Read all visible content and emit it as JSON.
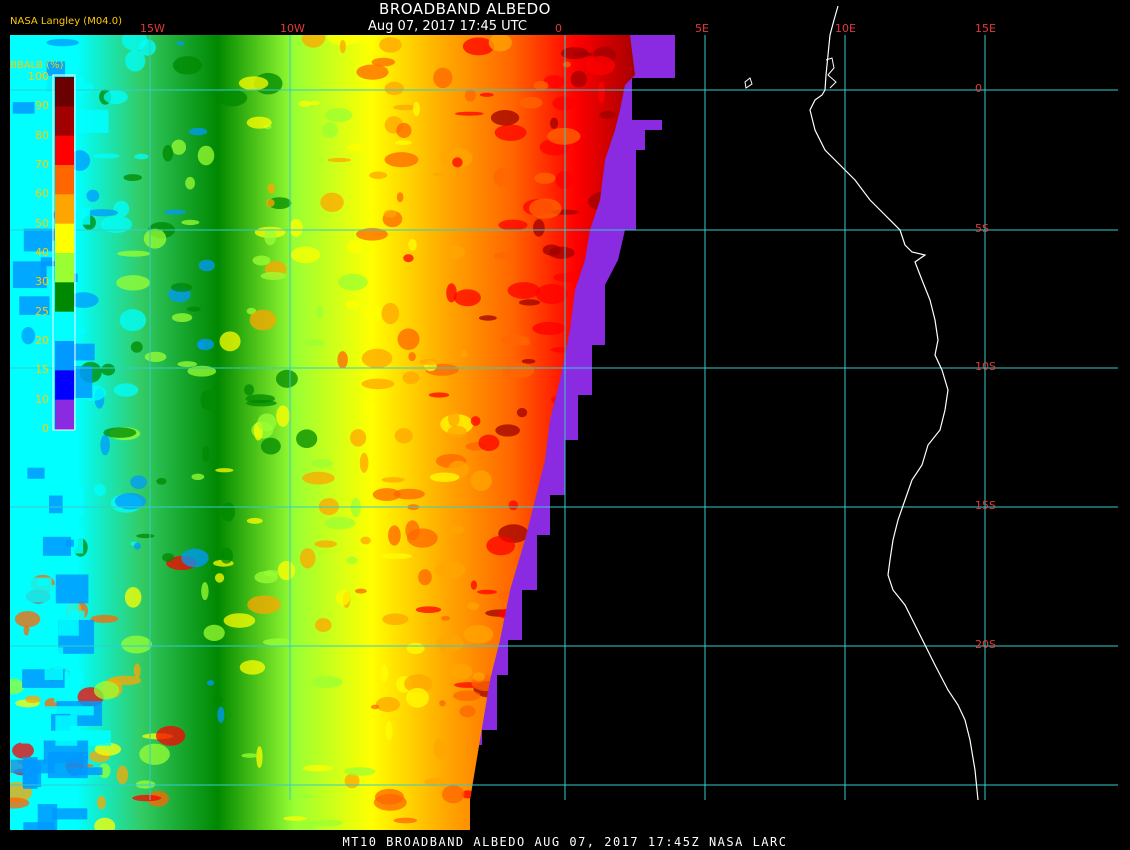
{
  "header": {
    "title": "BROADBAND ALBEDO",
    "subtitle": "Aug 07, 2017 17:45 UTC",
    "producer": "NASA Langley (M04.0)"
  },
  "footer": {
    "text": "MT10  BROADBAND ALBEDO   AUG 07, 2017 17:45Z   NASA LARC"
  },
  "colorbar": {
    "title": "BBALB (%)",
    "labels": [
      "100",
      "90",
      "80",
      "70",
      "60",
      "50",
      "40",
      "30",
      "25",
      "20",
      "15",
      "10",
      "0"
    ],
    "colors": [
      "#6b0000",
      "#a00000",
      "#ff0000",
      "#ff6600",
      "#ffa500",
      "#ffff00",
      "#99ff33",
      "#008800",
      "#00ffff",
      "#0099ff",
      "#0000ff",
      "#8a2be2"
    ]
  },
  "map": {
    "longitude_ticks": [
      "15W",
      "10W",
      "0",
      "5E",
      "10E",
      "15E"
    ],
    "latitude_ticks": [
      "0",
      "5S",
      "10S",
      "15S",
      "20S"
    ],
    "colors": {
      "grid": "#33cccc",
      "coastline": "#ffffff",
      "background": "#000000",
      "no_data_edge": "#8a2be2"
    }
  }
}
